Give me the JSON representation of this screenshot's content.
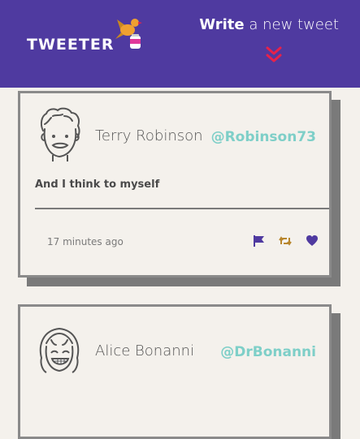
{
  "header": {
    "logo_text": "TWEETER",
    "compose_bold": "Write",
    "compose_rest": " a new tweet",
    "colors": {
      "header_bg": "#4f3aa0",
      "compose_chevron": "#e8214a"
    }
  },
  "tweets": [
    {
      "name": "Terry Robinson",
      "handle": "@Robinson73",
      "content": "And I think to myself",
      "time": "17 minutes ago",
      "avatar_icon": "male-avatar-icon"
    },
    {
      "name": "Alice Bonanni",
      "handle": "@DrBonanni",
      "content": "",
      "avatar_icon": "female-avatar-icon"
    }
  ],
  "actions": {
    "icons": [
      "flag-icon",
      "retweet-icon",
      "heart-icon"
    ],
    "colors": {
      "flag": "#4f3aa0",
      "retweet": "#b8862c",
      "heart": "#4f3aa0"
    }
  },
  "colors": {
    "page_bg": "#f4f1ec",
    "handle": "#7ecfc8",
    "card_border": "#8a8a8a"
  }
}
